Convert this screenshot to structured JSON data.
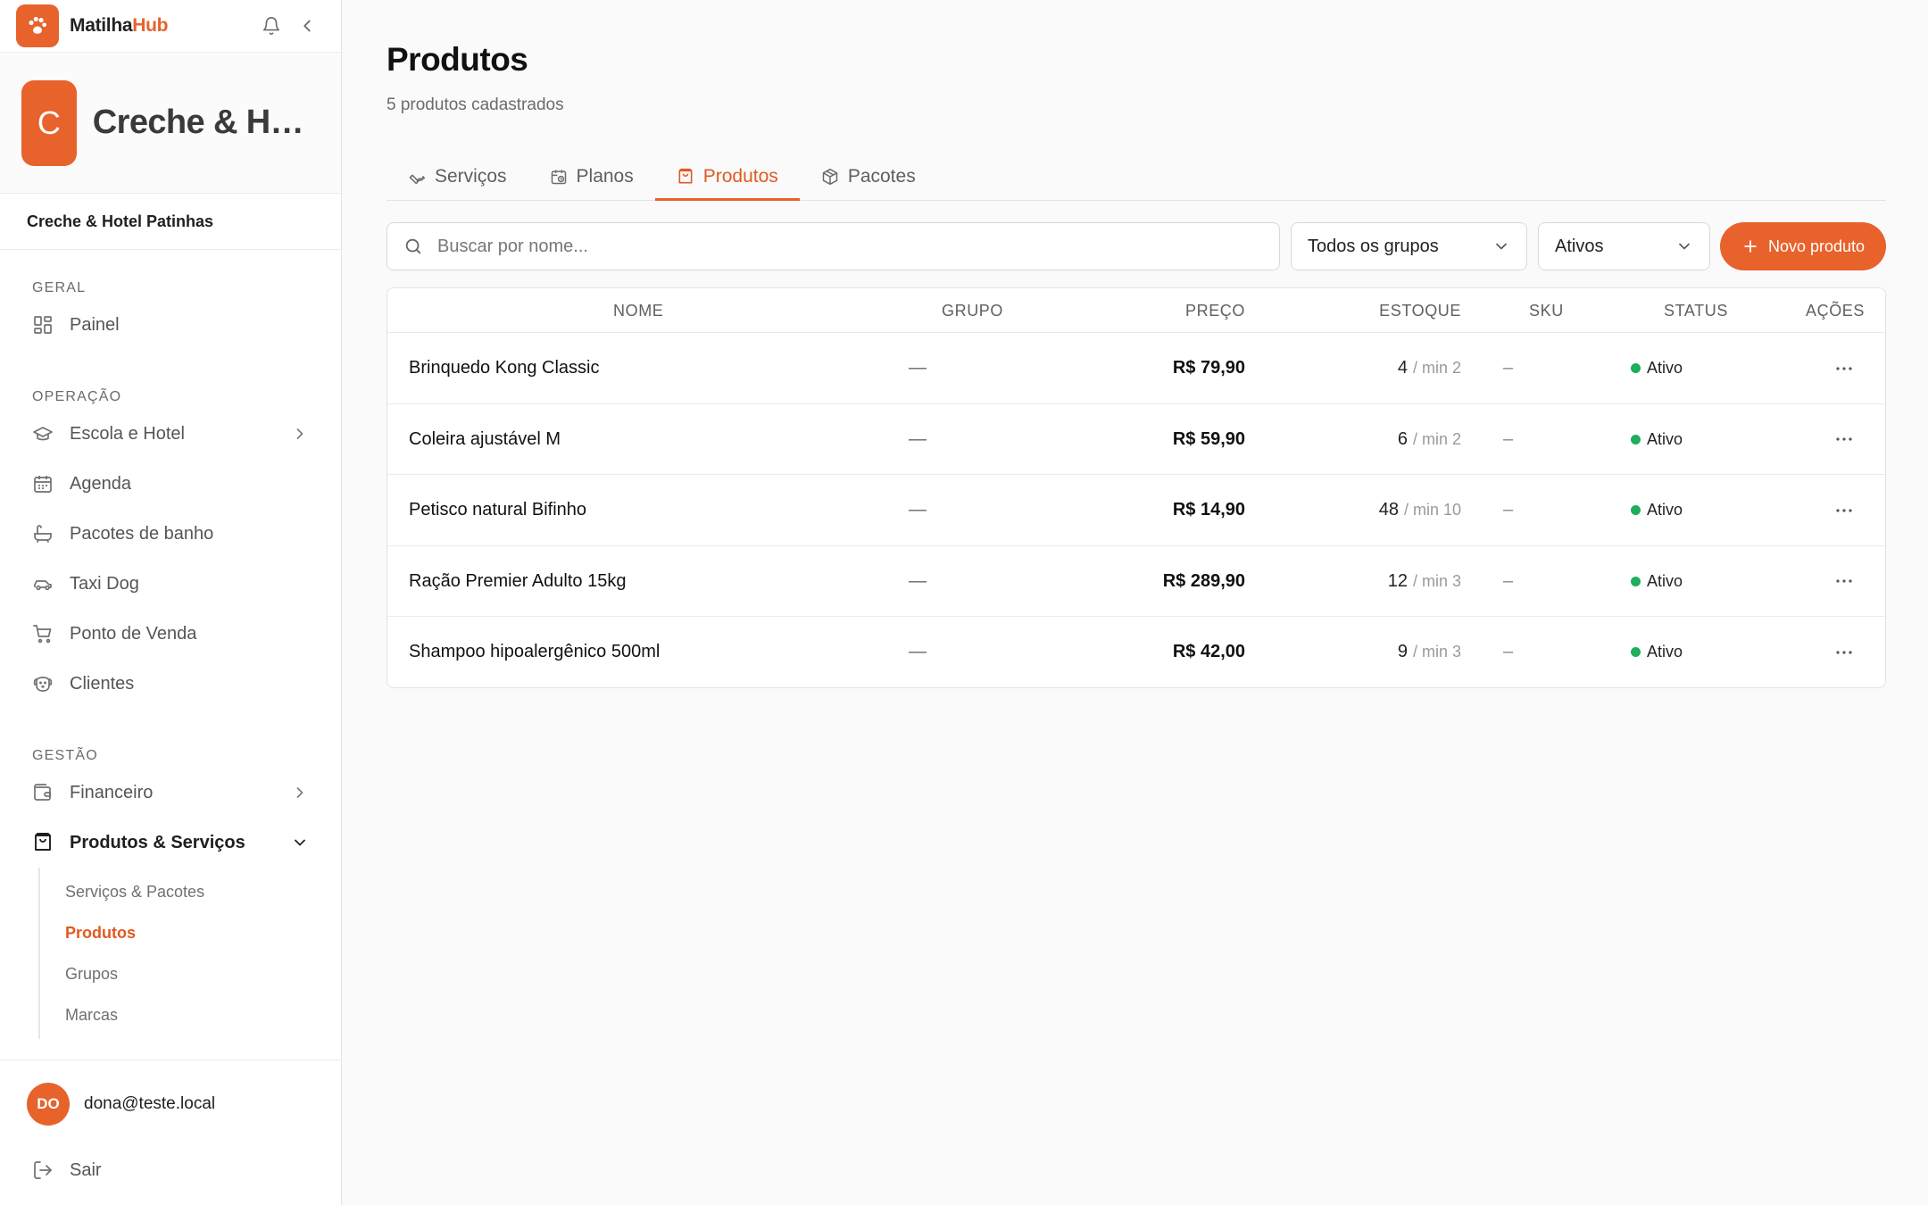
{
  "brand": {
    "name_main": "Matilha",
    "name_accent": "Hub"
  },
  "colors": {
    "accent": "#e8622c",
    "status_active": "#1fae5b"
  },
  "org": {
    "initial": "C",
    "short_name": "Creche & Hot…",
    "full_name": "Creche & Hotel Patinhas"
  },
  "nav": {
    "sections": [
      {
        "title": "GERAL",
        "items": [
          {
            "label": "Painel",
            "icon": "dashboard-icon"
          }
        ]
      },
      {
        "title": "OPERAÇÃO",
        "items": [
          {
            "label": "Escola e Hotel",
            "icon": "graduation-cap-icon",
            "chevron": true
          },
          {
            "label": "Agenda",
            "icon": "calendar-icon"
          },
          {
            "label": "Pacotes de banho",
            "icon": "bathtub-icon"
          },
          {
            "label": "Taxi Dog",
            "icon": "car-icon"
          },
          {
            "label": "Ponto de Venda",
            "icon": "cart-icon"
          },
          {
            "label": "Clientes",
            "icon": "dog-icon"
          }
        ]
      },
      {
        "title": "GESTÃO",
        "items": [
          {
            "label": "Financeiro",
            "icon": "wallet-icon",
            "chevron": true
          },
          {
            "label": "Produtos & Serviços",
            "icon": "shopping-bag-icon",
            "expanded": true
          }
        ]
      }
    ],
    "subitems": [
      {
        "label": "Serviços & Pacotes"
      },
      {
        "label": "Produtos",
        "active": true
      },
      {
        "label": "Grupos"
      },
      {
        "label": "Marcas"
      }
    ]
  },
  "user": {
    "initials": "DO",
    "email": "dona@teste.local",
    "logout_label": "Sair"
  },
  "page": {
    "title": "Produtos",
    "subtitle": "5 produtos cadastrados"
  },
  "tabs": [
    {
      "label": "Serviços",
      "icon": "wrench-icon"
    },
    {
      "label": "Planos",
      "icon": "calendar-clock-icon"
    },
    {
      "label": "Produtos",
      "icon": "shopping-bag-icon",
      "active": true
    },
    {
      "label": "Pacotes",
      "icon": "package-icon"
    }
  ],
  "toolbar": {
    "search_placeholder": "Buscar por nome...",
    "group_filter": "Todos os grupos",
    "status_filter": "Ativos",
    "new_button": "Novo produto"
  },
  "table": {
    "headers": {
      "name": "NOME",
      "group": "GRUPO",
      "price": "PREÇO",
      "stock": "ESTOQUE",
      "sku": "SKU",
      "status": "STATUS",
      "actions": "AÇÕES"
    },
    "rows": [
      {
        "name": "Brinquedo Kong Classic",
        "group": "—",
        "price": "R$ 79,90",
        "stock": "4",
        "min": "/ min 2",
        "sku": "–",
        "status": "Ativo"
      },
      {
        "name": "Coleira ajustável M",
        "group": "—",
        "price": "R$ 59,90",
        "stock": "6",
        "min": "/ min 2",
        "sku": "–",
        "status": "Ativo"
      },
      {
        "name": "Petisco natural Bifinho",
        "group": "—",
        "price": "R$ 14,90",
        "stock": "48",
        "min": "/ min 10",
        "sku": "–",
        "status": "Ativo"
      },
      {
        "name": "Ração Premier Adulto 15kg",
        "group": "—",
        "price": "R$ 289,90",
        "stock": "12",
        "min": "/ min 3",
        "sku": "–",
        "status": "Ativo"
      },
      {
        "name": "Shampoo hipoalergênico 500ml",
        "group": "—",
        "price": "R$ 42,00",
        "stock": "9",
        "min": "/ min 3",
        "sku": "–",
        "status": "Ativo"
      }
    ]
  }
}
